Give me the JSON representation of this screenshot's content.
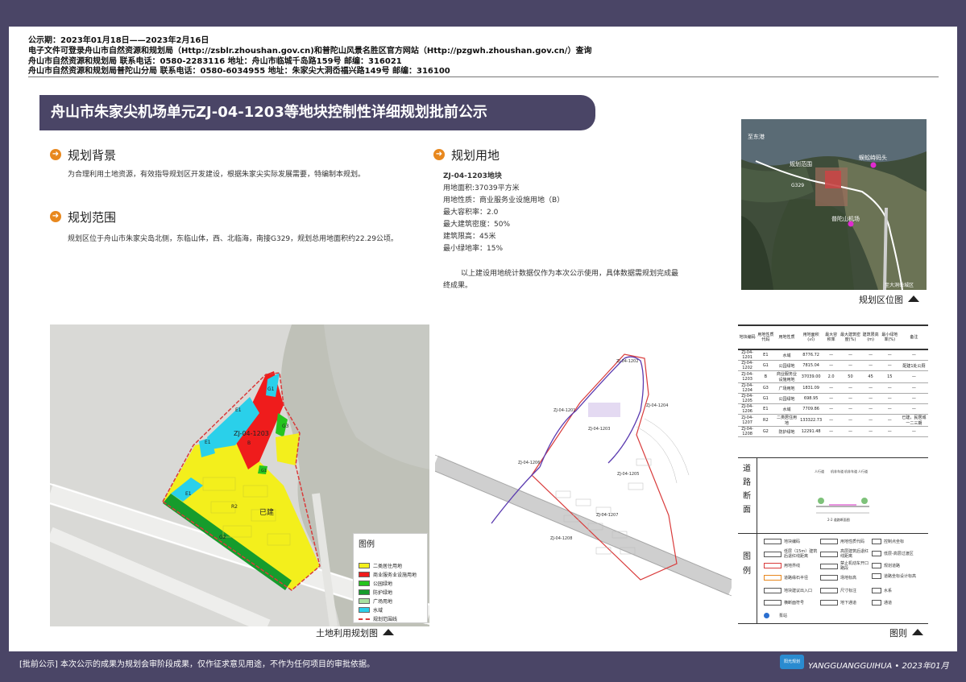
{
  "header": {
    "line1": "公示期：2023年01月18日——2023年2月16日",
    "line2": "电子文件可登录舟山市自然资源和规划局（Http://zsblr.zhoushan.gov.cn)和普陀山风景名胜区官方网站（Http://pzgwh.zhoushan.gov.cn/）查询",
    "line3": "舟山市自然资源和规划局             联系电话：0580-2283116   地址：舟山市临城千岛路159号        邮编：316021",
    "line4": "舟山市自然资源和规划局普陀山分局   联系电话：0580-6034955   地址：朱家尖大洞岙福兴路149号      邮编：316100"
  },
  "title": "舟山市朱家尖机场单元ZJ-04-1203等地块控制性详细规划批前公示",
  "background": {
    "heading": "规划背景",
    "text": "为合理利用土地资源，有效指导规划区开发建设，根据朱家尖实际发展需要，特编制本规划。"
  },
  "scope": {
    "heading": "规划范围",
    "text": "规划区位于舟山市朱家尖岛北侧，东临山体，西、北临海，南接G329，规划总用地面积约22.29公顷。"
  },
  "landuse": {
    "heading": "规划用地",
    "plot": "ZJ-04-1203地块",
    "lines": [
      "用地面积:37039平方米",
      "用地性质：商业服务业设施用地（B）",
      "最大容积率：2.0",
      "最大建筑密度：50%",
      "建筑限高：45米",
      "最小绿地率：15%"
    ],
    "note": "以上建设用地统计数据仅作为本次公示使用，具体数据需规划完成最终成果。"
  },
  "location_map": {
    "labels": {
      "to_donggang": "至东港",
      "scope": "规划范围",
      "road": "G329",
      "wharf": "蜈蚣峙码头",
      "airport": "普陀山机场",
      "to_city": "至大洞岙城区"
    },
    "caption": "规划区位图"
  },
  "land_map": {
    "caption": "土地利用规划图",
    "plot_label": "ZJ-04-1203",
    "plot_code": "B",
    "built": "已建",
    "parcel_codes": [
      "E1",
      "G1",
      "G3",
      "E1",
      "G1",
      "R2",
      "G2",
      "E1"
    ],
    "legend_title": "图例",
    "legend": [
      {
        "code": "R2",
        "label": "二类居住用地",
        "color": "#f3ef1c"
      },
      {
        "code": "B",
        "label": "商业服务业设施用地",
        "color": "#ef1c1c"
      },
      {
        "code": "G1",
        "label": "公园绿地",
        "color": "#25c41e"
      },
      {
        "code": "G2",
        "label": "防护绿地",
        "color": "#169c2c"
      },
      {
        "code": "G3",
        "label": "广场用地",
        "color": "#a8e0a0"
      },
      {
        "code": "E1",
        "label": "水域",
        "color": "#2ad0ea"
      },
      {
        "code": "",
        "label": "规划范围线",
        "color": "#d93b3b"
      }
    ]
  },
  "control_map": {
    "caption": "图则",
    "labels": [
      "ZJ-04-1201",
      "ZJ-04-1202",
      "ZJ-04-1203",
      "ZJ-04-1204",
      "ZJ-04-1205",
      "ZJ-04-1206",
      "ZJ-04-1207",
      "ZJ-04-1208"
    ]
  },
  "plot_table": {
    "headers": [
      "地块编码",
      "用地性质代码",
      "用地性质",
      "用地面积(㎡)",
      "最大容积率",
      "最大建筑密度(%)",
      "建筑限高(m)",
      "最小绿地率(%)",
      "备注"
    ],
    "rows": [
      [
        "ZJ-04-1201",
        "E1",
        "水域",
        "8776.72",
        "—",
        "—",
        "—",
        "—",
        "—"
      ],
      [
        "ZJ-04-1202",
        "G1",
        "公园绿地",
        "7815.04",
        "—",
        "—",
        "—",
        "—",
        "配建1处公厕"
      ],
      [
        "ZJ-04-1203",
        "B",
        "商业服务业设施用地",
        "37039.00",
        "2.0",
        "50",
        "45",
        "15",
        "—"
      ],
      [
        "ZJ-04-1204",
        "G3",
        "广场用地",
        "1831.09",
        "—",
        "—",
        "—",
        "—",
        "—"
      ],
      [
        "ZJ-04-1205",
        "G1",
        "公园绿地",
        "698.95",
        "—",
        "—",
        "—",
        "—",
        "—"
      ],
      [
        "ZJ-04-1206",
        "E1",
        "水域",
        "7709.86",
        "—",
        "—",
        "—",
        "—",
        "—"
      ],
      [
        "ZJ-04-1207",
        "R2",
        "二类居住用地",
        "133322.73",
        "—",
        "—",
        "—",
        "—",
        "已建，民居城一二三期"
      ],
      [
        "ZJ-04-1208",
        "G2",
        "防护绿地",
        "12291.48",
        "—",
        "—",
        "—",
        "—",
        "—"
      ]
    ]
  },
  "road_section": {
    "label": "道路断面",
    "lanes": [
      "人行道",
      "机非车道",
      "机非车道",
      "人行道"
    ],
    "name": "2-2 道路断面图"
  },
  "legend_panel": {
    "label": "图例",
    "items": [
      "地块编码",
      "用地性质代码",
      "控制点坐标",
      "低层（15m）建筑后退红线距离",
      "高层建筑后退红线距离",
      "低层-高层过渡区",
      "用地界线",
      "禁止机动车开口路段",
      "规划道路",
      "道路缘石半径",
      "场地标高",
      "道路坐标设计标高",
      "地块建议出入口",
      "尺寸标注",
      "水系",
      "横断面符号",
      "地下通道",
      "通道",
      "泵站"
    ]
  },
  "footer": {
    "text": "[批前公示]   本次公示的成果为规划会审阶段成果，仅作征求意见用途，不作为任何项目的审批依据。",
    "logo": "阳光规划",
    "brand": "YANGGUANGGUIHUA • 2023年01月"
  },
  "colors": {
    "frame": "#4a4566",
    "accent": "#e8881e",
    "residential": "#f3ef1c",
    "commercial": "#ef1c1c",
    "park": "#25c41e",
    "protective": "#169c2c",
    "plaza": "#a8e0a0",
    "water": "#2ad0ea",
    "boundary": "#d93b3b"
  }
}
